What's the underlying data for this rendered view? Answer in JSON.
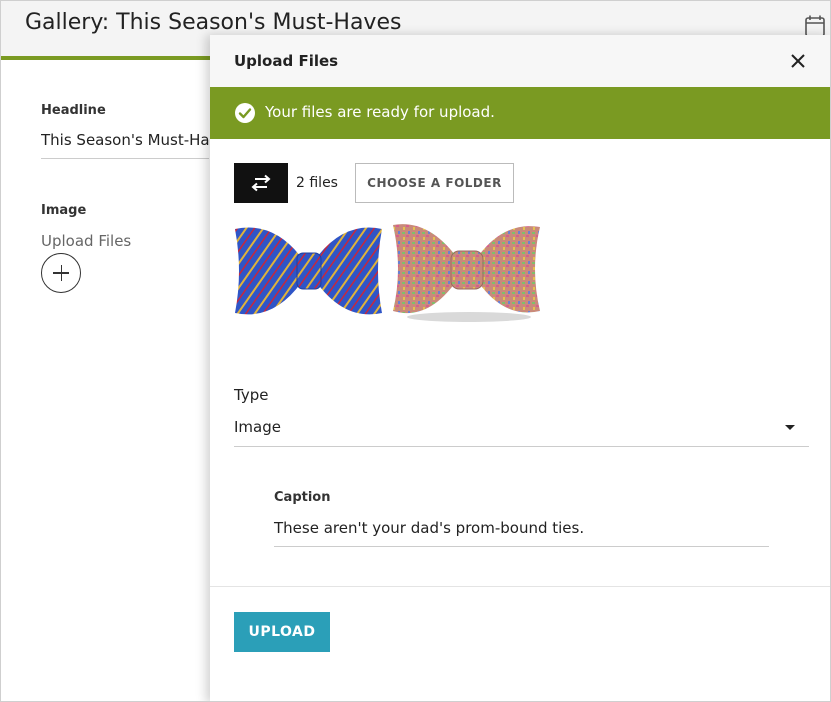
{
  "page": {
    "title": "Gallery: This Season's Must-Haves",
    "calendar_icon": "calendar-icon",
    "accent_color": "#7a9a22"
  },
  "form": {
    "headline_label": "Headline",
    "headline_value": "This Season's Must-Haves",
    "image_label": "Image",
    "upload_link": "Upload Files",
    "add_icon": "plus-circle-icon"
  },
  "modal": {
    "title": "Upload Files",
    "close_icon": "close-icon",
    "banner": {
      "text": "Your files are ready for upload.",
      "icon": "check-circle-icon",
      "color": "#7a9a22"
    },
    "swap_icon": "swap-arrows-icon",
    "file_count": "2 files",
    "choose_folder_label": "CHOOSE A FOLDER",
    "thumbnails": [
      {
        "name": "blue-striped-bow-tie"
      },
      {
        "name": "multicolor-print-bow-tie"
      }
    ],
    "type_label": "Type",
    "type_value": "Image",
    "caption_label": "Caption",
    "caption_value": "These aren't your dad's prom-bound ties.",
    "upload_label": "UPLOAD",
    "upload_color": "#2b9fb8"
  }
}
